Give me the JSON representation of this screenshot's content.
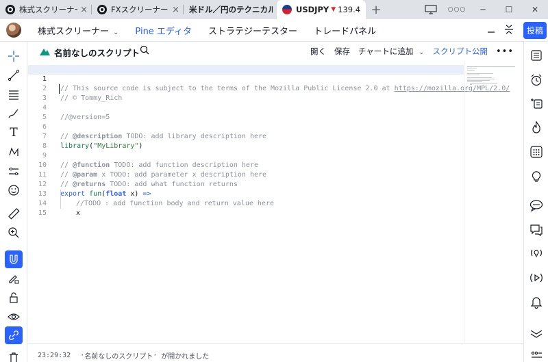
{
  "browser": {
    "tabs": [
      {
        "title": "株式スクリーナー",
        "close": "×"
      },
      {
        "title": "FXスクリーナー",
        "close": "×"
      },
      {
        "title": "米ドル／円のテクニカル"
      },
      {
        "title": "USDJPY",
        "price": "139.4"
      }
    ],
    "new_tab": "+",
    "controls": {
      "more": "○○○",
      "minimize": "─",
      "maximize": "☐",
      "close": "✕"
    }
  },
  "header": {
    "nav": [
      {
        "label": "株式スクリーナー"
      },
      {
        "label": "Pine エディタ"
      },
      {
        "label": "ストラテジーテスター"
      },
      {
        "label": "トレードパネル"
      }
    ],
    "chevron": "⌄",
    "post_label": "投稿"
  },
  "editor": {
    "script_name": "名前なしのスクリプト",
    "actions": {
      "open": "開く",
      "save": "保存",
      "add_to_chart": "チャートに追加",
      "publish": "スクリプト公開",
      "more": "•••"
    },
    "lines": [
      "1",
      "2",
      "3",
      "4",
      "5",
      "6",
      "7",
      "8",
      "9",
      "10",
      "11",
      "12",
      "13",
      "14",
      "15"
    ],
    "code": {
      "l1_comment": "// This source code is subject to the terms of the Mozilla Public License 2.0 at ",
      "l1_link": "https://mozilla.org/MPL/2.0/",
      "l2": "// © Tommy_Rich",
      "l4": "//@version=5",
      "l6_prefix": "// ",
      "l6_tag": "@description",
      "l6_rest": " TODO: add library description here",
      "l7_fn": "library",
      "l7_open": "(",
      "l7_str": "\"MyLibrary\"",
      "l7_close": ")",
      "l9_prefix": "// ",
      "l9_tag": "@function",
      "l9_rest": " TODO: add function description here",
      "l10_prefix": "// ",
      "l10_tag": "@param",
      "l10_rest": " x TODO: add parameter x description here",
      "l11_prefix": "// ",
      "l11_tag": "@returns",
      "l11_rest": " TODO: add what function returns",
      "l12_export": "export",
      "l12_fn": "fun",
      "l12_open": "(",
      "l12_type": "float",
      "l12_rest": " x) ",
      "l12_arrow": "=>",
      "l13": "//TODO : add function body and return value here",
      "l14": "x"
    },
    "status": {
      "time": "23:29:32",
      "message": "'名前なしのスクリプト' が開かれました"
    }
  }
}
